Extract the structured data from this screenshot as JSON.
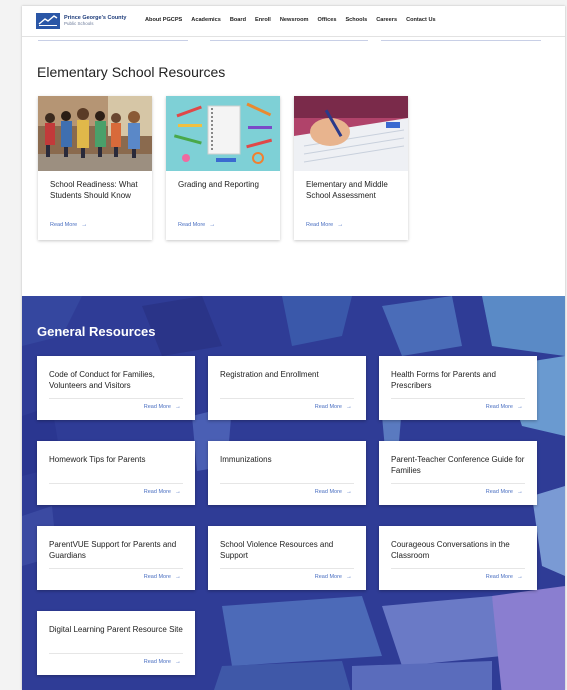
{
  "header": {
    "logo_name": "Prince George's County",
    "logo_sub": "Public Schools",
    "nav": [
      "About PGCPS",
      "Academics",
      "Board",
      "Enroll",
      "Newsroom",
      "Offices",
      "Schools",
      "Careers",
      "Contact Us"
    ]
  },
  "elementary": {
    "title": "Elementary School Resources",
    "cards": [
      {
        "title": "School Readiness: What Students Should Know",
        "link": "Read More"
      },
      {
        "title": "Grading and Reporting",
        "link": "Read More"
      },
      {
        "title": "Elementary and Middle School Assessment",
        "link": "Read More"
      }
    ]
  },
  "general": {
    "title": "General Resources",
    "cards": [
      {
        "title": "Code of Conduct for Families, Volunteers and Visitors",
        "link": "Read More"
      },
      {
        "title": "Registration and Enrollment",
        "link": "Read More"
      },
      {
        "title": "Health Forms for Parents and Prescribers",
        "link": "Read More"
      },
      {
        "title": "Homework Tips for Parents",
        "link": "Read More"
      },
      {
        "title": "Immunizations",
        "link": "Read More"
      },
      {
        "title": "Parent-Teacher Conference Guide for Families",
        "link": "Read More"
      },
      {
        "title": "ParentVUE Support for Parents and Guardians",
        "link": "Read More"
      },
      {
        "title": "School Violence Resources and Support",
        "link": "Read More"
      },
      {
        "title": "Courageous Conversations in the Classroom",
        "link": "Read More"
      },
      {
        "title": "Digital Learning Parent Resource Site",
        "link": "Read More"
      }
    ]
  },
  "icons": {
    "read_more": "arrow-right-icon",
    "logo": "pgcps-logo-icon"
  },
  "colors": {
    "brand_blue": "#2a56a6",
    "section_bg": "#2f3c96",
    "link": "#4a6fc1"
  }
}
